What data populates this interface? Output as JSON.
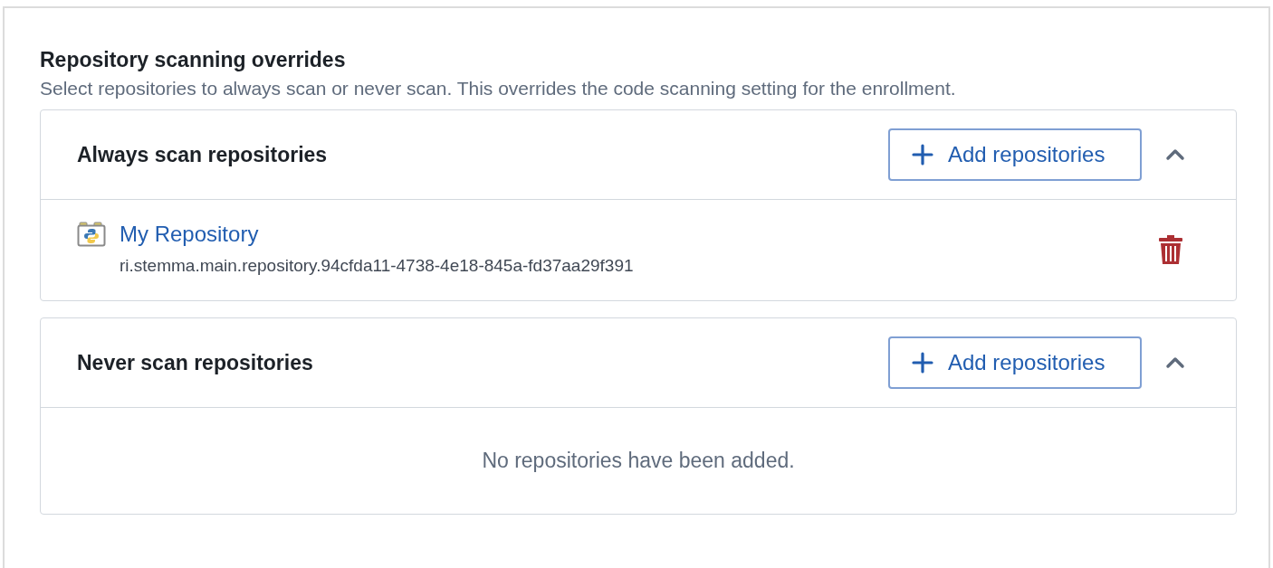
{
  "title": "Repository scanning overrides",
  "description": "Select repositories to always scan or never scan. This overrides the code scanning setting for the enrollment.",
  "sections": [
    {
      "title": "Always scan repositories",
      "button": "Add repositories",
      "expanded": true,
      "repositories": [
        {
          "name": "My Repository",
          "rid": "ri.stemma.main.repository.94cfda11-4738-4e18-845a-fd37aa29f391"
        }
      ]
    },
    {
      "title": "Never scan repositories",
      "button": "Add repositories",
      "expanded": true,
      "empty_text": "No repositories have been added."
    }
  ]
}
